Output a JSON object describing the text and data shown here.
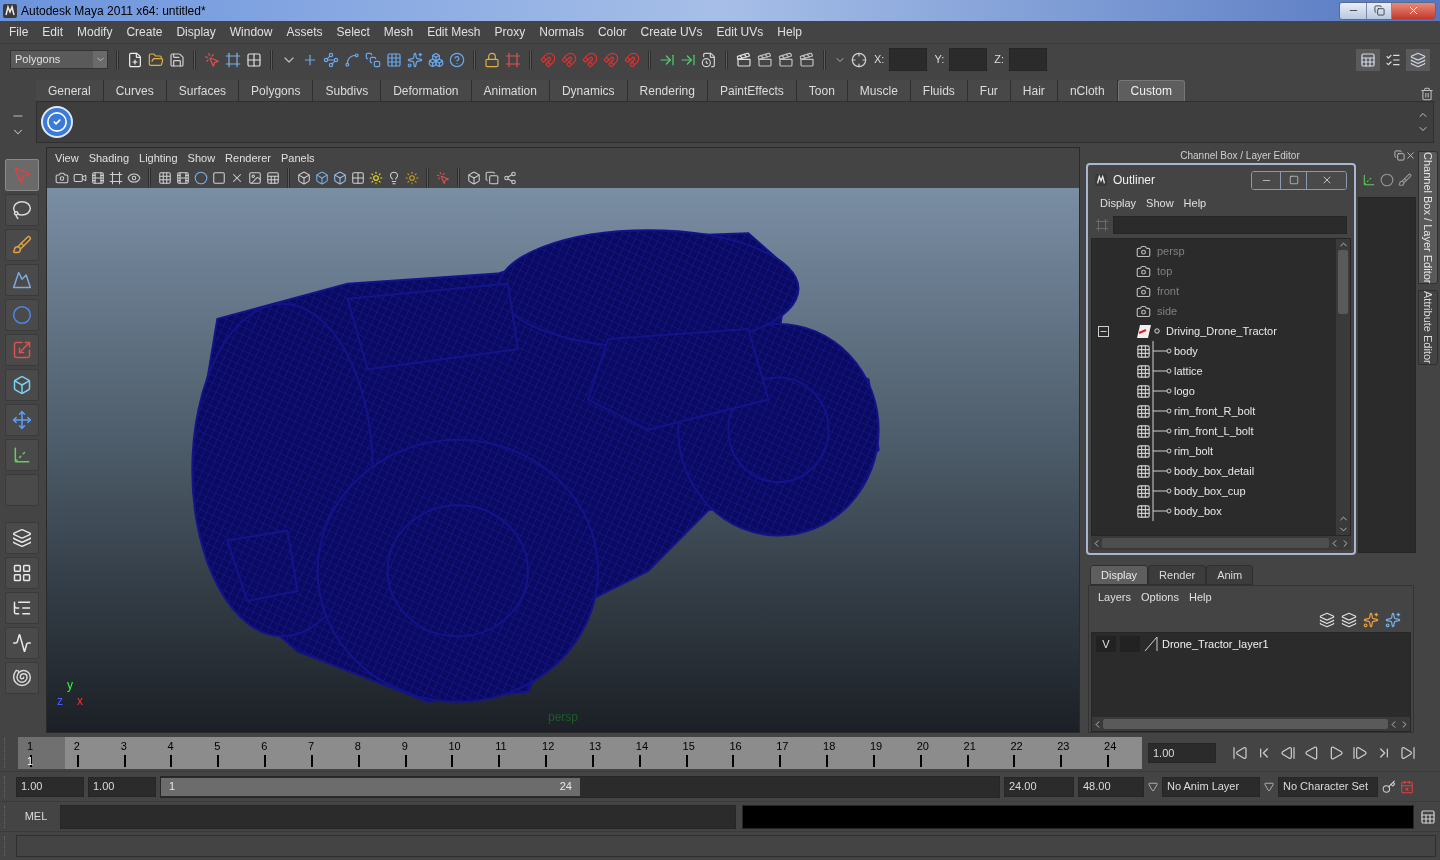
{
  "window": {
    "title": "Autodesk Maya 2011 x64: untitled*"
  },
  "menubar": [
    "File",
    "Edit",
    "Modify",
    "Create",
    "Display",
    "Window",
    "Assets",
    "Select",
    "Mesh",
    "Edit Mesh",
    "Proxy",
    "Normals",
    "Color",
    "Create UVs",
    "Edit UVs",
    "Help"
  ],
  "status_line": {
    "mode": "Polygons",
    "coord_labels": [
      "X:",
      "Y:",
      "Z:"
    ]
  },
  "shelf": {
    "tabs": [
      {
        "label": "General",
        "selected": false
      },
      {
        "label": "Curves",
        "selected": false
      },
      {
        "label": "Surfaces",
        "selected": false
      },
      {
        "label": "Polygons",
        "selected": false
      },
      {
        "label": "Subdivs",
        "selected": false
      },
      {
        "label": "Deformation",
        "selected": false
      },
      {
        "label": "Animation",
        "selected": false
      },
      {
        "label": "Dynamics",
        "selected": false
      },
      {
        "label": "Rendering",
        "selected": false
      },
      {
        "label": "PaintEffects",
        "selected": false
      },
      {
        "label": "Toon",
        "selected": false
      },
      {
        "label": "Muscle",
        "selected": false
      },
      {
        "label": "Fluids",
        "selected": false
      },
      {
        "label": "Fur",
        "selected": false
      },
      {
        "label": "Hair",
        "selected": false
      },
      {
        "label": "nCloth",
        "selected": false
      },
      {
        "label": "Custom",
        "selected": true
      }
    ]
  },
  "toolbox": [
    {
      "kind": "select",
      "selected": true
    },
    {
      "kind": "lasso",
      "selected": false
    },
    {
      "kind": "paint",
      "selected": false
    },
    {
      "kind": "sculpt",
      "selected": false
    },
    {
      "kind": "sphere",
      "selected": false
    },
    {
      "kind": "scale",
      "selected": false
    },
    {
      "kind": "manip",
      "selected": false
    },
    {
      "kind": "move",
      "selected": false
    },
    {
      "kind": "axes",
      "selected": false
    },
    {
      "kind": "empty",
      "selected": false
    },
    {
      "kind": "layout_single",
      "selected": false
    },
    {
      "kind": "layout_four",
      "selected": false
    },
    {
      "kind": "layout_outliner",
      "selected": false
    },
    {
      "kind": "layout_graph",
      "selected": false
    },
    {
      "kind": "shell",
      "selected": false
    }
  ],
  "viewport": {
    "menu": [
      "View",
      "Shading",
      "Lighting",
      "Show",
      "Renderer",
      "Panels"
    ],
    "axis_labels": [
      "y",
      "z",
      "x"
    ],
    "camera_label": "persp"
  },
  "channel_box": {
    "title": "Channel Box / Layer Editor"
  },
  "outliner": {
    "title": "Outliner",
    "menu": [
      "Display",
      "Show",
      "Help"
    ],
    "items": [
      {
        "kind": "camera",
        "label": "persp",
        "dimmed": true
      },
      {
        "kind": "camera",
        "label": "top",
        "dimmed": true
      },
      {
        "kind": "camera",
        "label": "front",
        "dimmed": true
      },
      {
        "kind": "camera",
        "label": "side",
        "dimmed": true
      },
      {
        "kind": "group",
        "label": "Driving_Drone_Tractor",
        "dimmed": false,
        "expanded": true,
        "children": [
          {
            "kind": "mesh",
            "label": "body",
            "dimmed": false
          },
          {
            "kind": "mesh",
            "label": "lattice",
            "dimmed": false
          },
          {
            "kind": "mesh",
            "label": "logo",
            "dimmed": false
          },
          {
            "kind": "mesh",
            "label": "rim_front_R_bolt",
            "dimmed": false
          },
          {
            "kind": "mesh",
            "label": "rim_front_L_bolt",
            "dimmed": false
          },
          {
            "kind": "mesh",
            "label": "rim_bolt",
            "dimmed": false
          },
          {
            "kind": "mesh",
            "label": "body_box_detail",
            "dimmed": false
          },
          {
            "kind": "mesh",
            "label": "body_box_cup",
            "dimmed": false
          },
          {
            "kind": "mesh",
            "label": "body_box",
            "dimmed": false
          }
        ]
      }
    ]
  },
  "layer_editor": {
    "tabs": [
      {
        "label": "Display",
        "selected": true
      },
      {
        "label": "Render",
        "selected": false
      },
      {
        "label": "Anim",
        "selected": false
      }
    ],
    "menu": [
      "Layers",
      "Options",
      "Help"
    ],
    "layers": [
      {
        "visibility": "V",
        "name": "Drone_Tractor_layer1"
      }
    ]
  },
  "side_tabs": [
    {
      "label": "Channel Box / Layer Editor",
      "selected": true
    },
    {
      "label": "Attribute Editor",
      "selected": false
    }
  ],
  "timeline": {
    "frames": [
      {
        "label": "1",
        "selected": true
      },
      {
        "label": "2",
        "selected": false
      },
      {
        "label": "3",
        "selected": false
      },
      {
        "label": "4",
        "selected": false
      },
      {
        "label": "5",
        "selected": false
      },
      {
        "label": "6",
        "selected": false
      },
      {
        "label": "7",
        "selected": false
      },
      {
        "label": "8",
        "selected": false
      },
      {
        "label": "9",
        "selected": false
      },
      {
        "label": "10",
        "selected": false
      },
      {
        "label": "11",
        "selected": false
      },
      {
        "label": "12",
        "selected": false
      },
      {
        "label": "13",
        "selected": false
      },
      {
        "label": "14",
        "selected": false
      },
      {
        "label": "15",
        "selected": false
      },
      {
        "label": "16",
        "selected": false
      },
      {
        "label": "17",
        "selected": false
      },
      {
        "label": "18",
        "selected": false
      },
      {
        "label": "19",
        "selected": false
      },
      {
        "label": "20",
        "selected": false
      },
      {
        "label": "21",
        "selected": false
      },
      {
        "label": "22",
        "selected": false
      },
      {
        "label": "23",
        "selected": false
      },
      {
        "label": "24",
        "selected": false
      }
    ],
    "current_frame": "1",
    "current_time": "1.00"
  },
  "range": {
    "start": "1.00",
    "playback_start": "1.00",
    "slider_start": "1",
    "slider_end": "24",
    "level": 0.5,
    "playback_end": "24.00",
    "end": "48.00",
    "anim_layer": "No Anim Layer",
    "character_set": "No Character Set"
  },
  "command_line": {
    "label": "MEL"
  }
}
